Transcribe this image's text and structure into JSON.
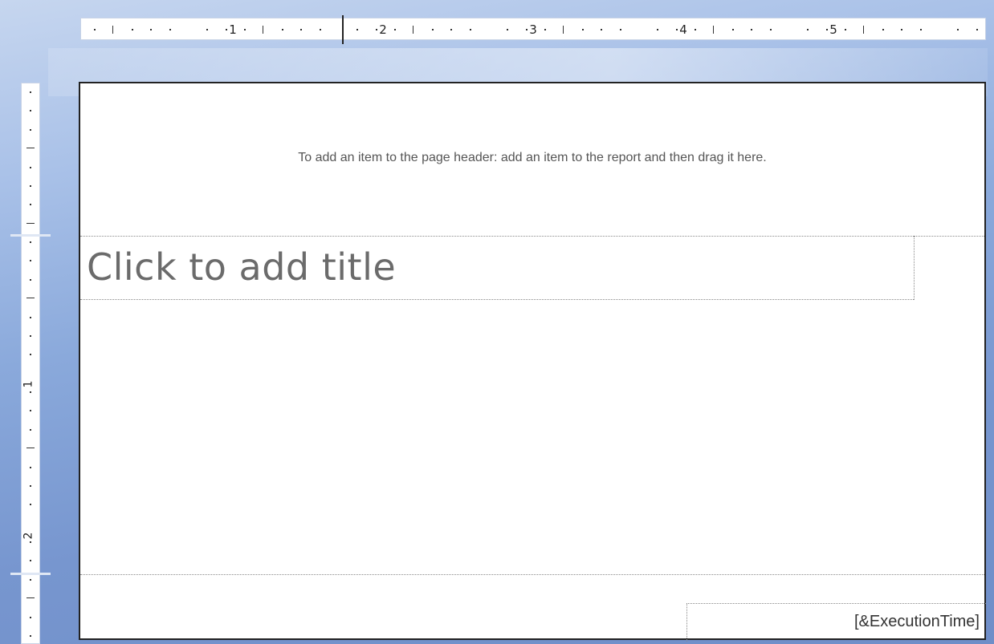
{
  "ruler_top": {
    "labels": [
      "1",
      "2",
      "3",
      "4",
      "5"
    ]
  },
  "ruler_left": {
    "labels": [
      "1",
      "2"
    ]
  },
  "page_header": {
    "hint": "To add an item to the page header: add an item to the report and then drag it here."
  },
  "body": {
    "title_placeholder": "Click to add title"
  },
  "page_footer": {
    "execution_time": "[&ExecutionTime]"
  },
  "colors": {
    "workspace": "#7f9fd4",
    "page": "#ffffff",
    "placeholder_text": "#6b6b6b"
  }
}
